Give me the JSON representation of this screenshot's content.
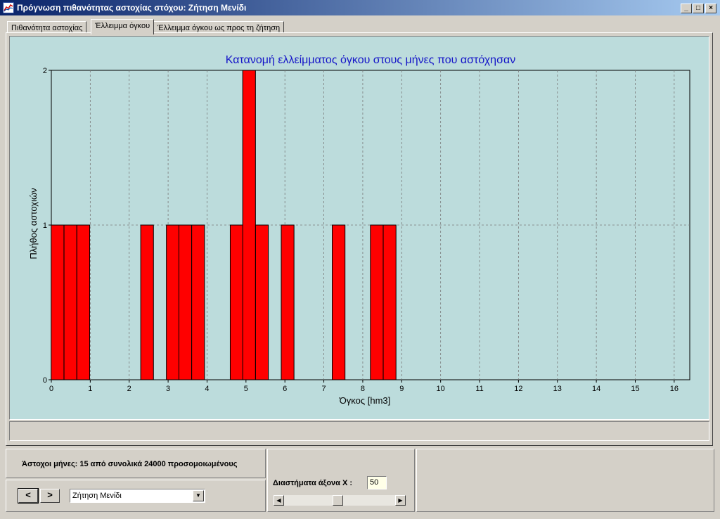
{
  "window": {
    "title": "Πρόγνωση πιθανότητας αστοχίας στόχου: Ζήτηση Μενίδι",
    "minimize_glyph": "_",
    "maximize_glyph": "□",
    "close_glyph": "×"
  },
  "tabs": [
    {
      "label": "Πιθανότητα αστοχίας",
      "active": false
    },
    {
      "label": "Έλλειμμα όγκου",
      "active": true
    },
    {
      "label": "Έλλειμμα όγκου ως προς τη ζήτηση",
      "active": false
    }
  ],
  "chart_data": {
    "type": "bar",
    "title": "Κατανομή ελλείμματος όγκου στους μήνες που αστόχησαν",
    "xlabel": "Όγκος [hm3]",
    "ylabel": "Πλήθος αστοχιών",
    "xlim": [
      0,
      16.4
    ],
    "ylim": [
      0,
      2
    ],
    "x_ticks": [
      0,
      1,
      2,
      3,
      4,
      5,
      6,
      7,
      8,
      9,
      10,
      11,
      12,
      13,
      14,
      15,
      16
    ],
    "y_ticks": [
      0,
      1,
      2
    ],
    "bin_width": 0.328,
    "bars": [
      {
        "x": 0.16,
        "value": 1
      },
      {
        "x": 0.49,
        "value": 1
      },
      {
        "x": 0.82,
        "value": 1
      },
      {
        "x": 2.46,
        "value": 1
      },
      {
        "x": 3.12,
        "value": 1
      },
      {
        "x": 3.44,
        "value": 1
      },
      {
        "x": 3.77,
        "value": 1
      },
      {
        "x": 4.76,
        "value": 1
      },
      {
        "x": 5.08,
        "value": 2
      },
      {
        "x": 5.41,
        "value": 1
      },
      {
        "x": 6.07,
        "value": 1
      },
      {
        "x": 7.38,
        "value": 1
      },
      {
        "x": 8.36,
        "value": 1
      },
      {
        "x": 8.69,
        "value": 1
      }
    ],
    "grid": true,
    "colors": {
      "bar": "#ff0000",
      "title": "#1515c8",
      "background": "#bcdcdc",
      "grid": "#7a7a7a"
    }
  },
  "info": {
    "failed_months": "Άστοχοι μήνες: 15 από συνολικά 24000 προσομοιωμένους"
  },
  "nav": {
    "prev_label": "<",
    "next_label": ">",
    "target_value": "Ζήτηση Μενίδι",
    "dropdown_arrow": "▼"
  },
  "axis_controls": {
    "intervals_label": "Διαστήματα άξονα X :",
    "intervals_value": "50",
    "scroll_left": "◀",
    "scroll_right": "▶"
  }
}
